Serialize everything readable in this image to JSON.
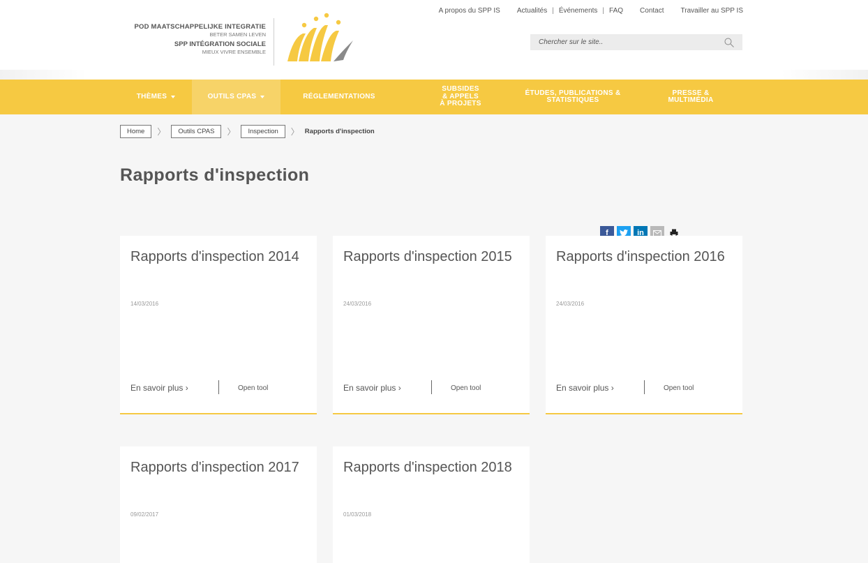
{
  "brand": {
    "line1": "POD MAATSCHAPPELIJKE INTEGRATIE",
    "line2": "BETER SAMEN LEVEN",
    "line3": "SPP INTÉGRATION SOCIALE",
    "line4": "MIEUX VIVRE ENSEMBLE"
  },
  "top_links": {
    "about": "A propos du SPP IS",
    "news": "Actualités",
    "events": "Événements",
    "faq": "FAQ",
    "contact": "Contact",
    "work": "Travailler au SPP IS",
    "separator": "|"
  },
  "search": {
    "placeholder": "Chercher sur le site..",
    "icon": "magnifier-icon"
  },
  "nav": [
    {
      "label": "THÈMES"
    },
    {
      "label": "OUTILS CPAS"
    },
    {
      "label": "RÉGLEMENTATIONS"
    },
    {
      "label": "SUBSIDES & APPELS À PROJETS"
    },
    {
      "label": "ÉTUDES, PUBLICATIONS & STATISTIQUES"
    },
    {
      "label": "PRESSE & MULTIMÉDIA"
    }
  ],
  "breadcrumb": {
    "home": "Home",
    "outils": "Outils CPAS",
    "inspection": "Inspection",
    "current": "Rapports d'inspection",
    "arrow": "〉"
  },
  "page_title": "Rapports d'inspection",
  "share": {
    "facebook": "f",
    "linkedin": "in"
  },
  "cards": [
    {
      "title": "Rapports d'inspection 2014",
      "date": "14/03/2016",
      "more": "En savoir plus ›",
      "tool": "Open tool"
    },
    {
      "title": "Rapports d'inspection 2015",
      "date": "24/03/2016",
      "more": "En savoir plus ›",
      "tool": "Open tool"
    },
    {
      "title": "Rapports d'inspection 2016",
      "date": "24/03/2016",
      "more": "En savoir plus ›",
      "tool": "Open tool"
    },
    {
      "title": "Rapports d'inspection 2017",
      "date": "09/02/2017"
    },
    {
      "title": "Rapports d'inspection 2018",
      "date": "01/03/2018"
    }
  ],
  "colors": {
    "accent": "#f6c942",
    "accent_light": "#f7d368",
    "background": "#f6f6f6",
    "text": "#555555"
  }
}
